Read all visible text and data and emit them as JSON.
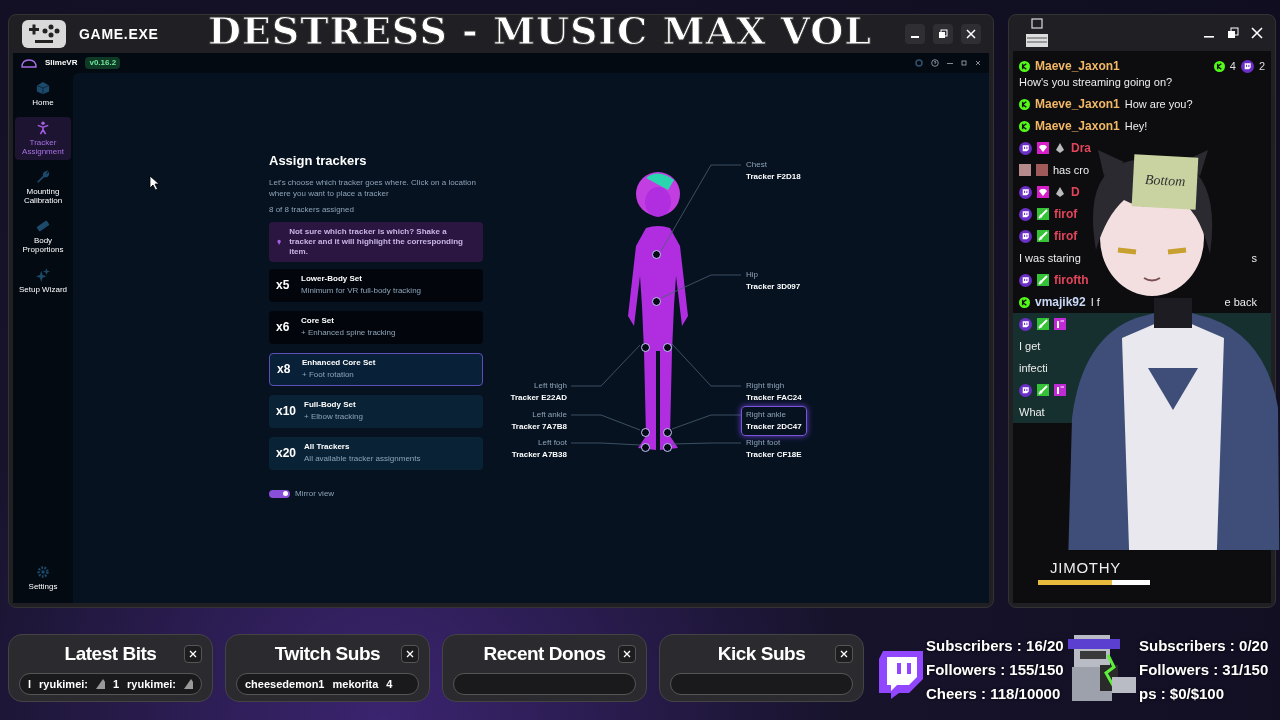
{
  "stream_title": "DESTRESS - MUSIC MAX VOL",
  "game_window": {
    "title": "GAME.EXE"
  },
  "app": {
    "name": "SlimeVR",
    "version": "v0.16.2"
  },
  "sidebar": {
    "items": [
      {
        "label": "Home",
        "selected": false
      },
      {
        "label": "Tracker Assignment",
        "selected": true
      },
      {
        "label": "Mounting Calibration",
        "selected": false
      },
      {
        "label": "Body Proportions",
        "selected": false
      },
      {
        "label": "Setup Wizard",
        "selected": false
      }
    ],
    "footer": {
      "label": "Settings",
      "selected": false
    }
  },
  "assign": {
    "title": "Assign trackers",
    "description": "Let's choose which tracker goes where. Click on a location where you want to place a tracker",
    "count": "8 of 8 trackers assigned",
    "tip": "Not sure which tracker is which? Shake a tracker and it will highlight the corresponding item.",
    "sets": [
      {
        "count": "x5",
        "title": "Lower-Body Set",
        "subtitle": "Minimum for VR full-body tracking",
        "selected": false
      },
      {
        "count": "x6",
        "title": "Core Set",
        "subtitle": "+ Enhanced spine tracking",
        "selected": false
      },
      {
        "count": "x8",
        "title": "Enhanced Core Set",
        "subtitle": "+ Foot rotation",
        "selected": true
      },
      {
        "count": "x10",
        "title": "Full-Body Set",
        "subtitle": "+ Elbow tracking",
        "selected": false
      },
      {
        "count": "x20",
        "title": "All Trackers",
        "subtitle": "All available tracker assignments",
        "selected": false
      }
    ],
    "mirror_view": {
      "label": "Mirror view",
      "on": true
    }
  },
  "body": {
    "trackers": [
      {
        "part": "Chest",
        "tracker": "Tracker F2D18",
        "selected": false
      },
      {
        "part": "Hip",
        "tracker": "Tracker 3D097",
        "selected": false
      },
      {
        "part": "Left thigh",
        "tracker": "Tracker E22AD",
        "selected": false
      },
      {
        "part": "Right thigh",
        "tracker": "Tracker FAC24",
        "selected": false
      },
      {
        "part": "Left ankle",
        "tracker": "Tracker 7A7B8",
        "selected": false
      },
      {
        "part": "Right ankle",
        "tracker": "Tracker 2DC47",
        "selected": true
      },
      {
        "part": "Left foot",
        "tracker": "Tracker A7B38",
        "selected": false
      },
      {
        "part": "Right foot",
        "tracker": "Tracker CF18E",
        "selected": false
      }
    ]
  },
  "chat": {
    "kick_count": "4",
    "twitch_count": "2",
    "messages": [
      {
        "kind": "kick",
        "user": "Maeve_Jaxon1",
        "color": "#f2b866",
        "text": "How's you streaming going on?",
        "newline": true,
        "highlighted": false
      },
      {
        "kind": "kick",
        "user": "Maeve_Jaxon1",
        "color": "#f2b866",
        "text": "How are you?",
        "newline": false,
        "highlighted": false
      },
      {
        "kind": "kick",
        "user": "Maeve_Jaxon1",
        "color": "#f2b866",
        "text": "Hey!",
        "newline": false,
        "highlighted": false
      },
      {
        "kind": "twitch",
        "badges": [
          {
            "kind": "gem"
          },
          {
            "kind": "drop"
          }
        ],
        "user": "Dra",
        "color": "#e0455a",
        "highlighted": false
      },
      {
        "kind": "emote",
        "text": "has cro",
        "newline": false,
        "highlighted": false
      },
      {
        "kind": "twitch",
        "badges": [
          {
            "kind": "gem"
          },
          {
            "kind": "drop"
          }
        ],
        "user": "D",
        "color": "#e0455a",
        "highlighted": false
      },
      {
        "kind": "twitch",
        "badges": [
          {
            "kind": "sword"
          }
        ],
        "user": "firof",
        "color": "#e0455a",
        "highlighted": false
      },
      {
        "kind": "twitch",
        "badges": [
          {
            "kind": "sword"
          }
        ],
        "user": "firof",
        "color": "#e0455a",
        "highlighted": false
      },
      {
        "kind": "plain",
        "text": "I was staring",
        "tail": "s",
        "newline": false,
        "highlighted": false
      },
      {
        "kind": "twitch",
        "badges": [
          {
            "kind": "sword"
          }
        ],
        "user": "firofth",
        "color": "#e0455a",
        "highlighted": false
      },
      {
        "kind": "kick",
        "user": "vmajik92",
        "color": "#c9d8f5",
        "text": "I f",
        "tail": "e back",
        "newline": false,
        "highlighted": false
      },
      {
        "kind": "twitch",
        "badges": [
          {
            "kind": "sword"
          },
          {
            "kind": "first"
          }
        ],
        "highlighted": true
      },
      {
        "kind": "plain",
        "text": "I get",
        "newline": false,
        "highlighted": true
      },
      {
        "kind": "plain",
        "text": "infecti",
        "newline": false,
        "highlighted": true
      },
      {
        "kind": "twitch",
        "badges": [
          {
            "kind": "sword"
          },
          {
            "kind": "first"
          }
        ],
        "highlighted": true
      },
      {
        "kind": "plain",
        "text": "What",
        "newline": false,
        "highlighted": true
      }
    ]
  },
  "vtuber": {
    "note": "Bottom",
    "name": "JIMOTHY",
    "level": 0.66
  },
  "widgets": [
    {
      "title": "Latest Bits",
      "items": [
        {
          "kind": "text",
          "text": "l"
        },
        {
          "kind": "text",
          "text": "ryukimei:"
        },
        {
          "kind": "bits"
        },
        {
          "kind": "text",
          "text": "1"
        },
        {
          "kind": "text",
          "text": "ryukimei:"
        },
        {
          "kind": "bits"
        }
      ]
    },
    {
      "title": "Twitch Subs",
      "items": [
        {
          "kind": "text",
          "text": "cheesedemon1"
        },
        {
          "kind": "text",
          "text": "mekorita"
        },
        {
          "kind": "text",
          "text": "4"
        }
      ]
    },
    {
      "title": "Recent Donos"
    },
    {
      "title": "Kick Subs"
    }
  ],
  "goals": {
    "twitch": [
      "Subscribers : 16/20",
      "Followers : 155/150",
      "Cheers : 118/10000"
    ],
    "kick": [
      "Subscribers : 0/20",
      "Followers : 31/150",
      "ps : $0/$100"
    ]
  }
}
